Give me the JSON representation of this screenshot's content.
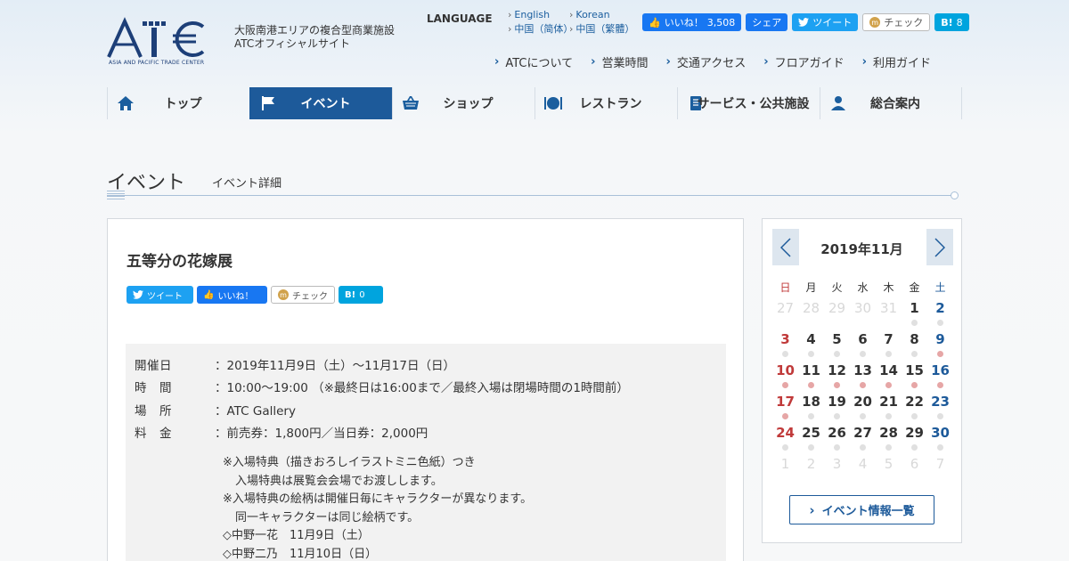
{
  "header": {
    "logo_text": "ATC",
    "logo_subtitle": "ASIA AND PACIFIC TRADE CENTER",
    "tagline_lines": [
      "大阪南港エリアの複合型商業施設",
      "ATCオフィシャルサイト"
    ],
    "language_label": "LANGUAGE",
    "languages": [
      "English",
      "Korean",
      "中国（简体）",
      "中国（繁體）"
    ],
    "social": {
      "like_label": "いいね！",
      "like_count": "3,508",
      "share_label": "シェア",
      "tweet_label": "ツイート",
      "check_label": "チェック",
      "hatena_label": "B!",
      "hatena_count": "8"
    },
    "util_links": [
      "ATCについて",
      "営業時間",
      "交通アクセス",
      "フロアガイド",
      "利用ガイド"
    ]
  },
  "nav": {
    "items": [
      {
        "label": "トップ",
        "icon": "home-icon"
      },
      {
        "label": "イベント",
        "icon": "flag-icon",
        "active": true
      },
      {
        "label": "ショップ",
        "icon": "basket-icon"
      },
      {
        "label": "レストラン",
        "icon": "dining-icon"
      },
      {
        "label": "サービス・公共施設",
        "icon": "notebook-icon"
      },
      {
        "label": "総合案内",
        "icon": "person-icon"
      }
    ]
  },
  "page": {
    "title": "イベント",
    "subtitle": "イベント詳細"
  },
  "event": {
    "title": "五等分の花嫁展",
    "share": {
      "tweet_label": "ツイート",
      "like_label": "いいね！",
      "check_label": "チェック",
      "hatena_label": "B!",
      "hatena_count": "0"
    },
    "info": [
      {
        "label": "開催日",
        "value": "：2019年11月9日（土）～11月17日（日）"
      },
      {
        "label": "時　間",
        "value": "：10:00～19:00 （※最終日は16:00まで／最終入場は閉場時間の1時間前）"
      },
      {
        "label": "場　所",
        "value": "：ATC Gallery"
      },
      {
        "label": "料　金",
        "value": "：前売券：1,800円／当日券：2,000円"
      }
    ],
    "notes": [
      {
        "text": "※入場特典（描きおろしイラストミニ色紙）つき",
        "indent": false
      },
      {
        "text": "入場特典は展覧会会場でお渡しします。",
        "indent": true
      },
      {
        "text": "※入場特典の絵柄は開催日毎にキャラクターが異なります。",
        "indent": false
      },
      {
        "text": "同一キャラクターは同じ絵柄です。",
        "indent": true
      },
      {
        "text": "◇中野一花　11月9日（土）",
        "indent": false
      },
      {
        "text": "◇中野二乃　11月10日（日）",
        "indent": false
      }
    ]
  },
  "calendar": {
    "month_label": "2019年11月",
    "weekdays": [
      "日",
      "月",
      "火",
      "水",
      "木",
      "金",
      "土"
    ],
    "weeks": [
      [
        {
          "d": "27",
          "m": true
        },
        {
          "d": "28",
          "m": true
        },
        {
          "d": "29",
          "m": true
        },
        {
          "d": "30",
          "m": true
        },
        {
          "d": "31",
          "m": true
        },
        {
          "d": "1"
        },
        {
          "d": "2"
        }
      ],
      [
        {
          "d": "3"
        },
        {
          "d": "4"
        },
        {
          "d": "5"
        },
        {
          "d": "6"
        },
        {
          "d": "7"
        },
        {
          "d": "8"
        },
        {
          "d": "9",
          "ev": true
        }
      ],
      [
        {
          "d": "10",
          "ev": true
        },
        {
          "d": "11",
          "ev": true
        },
        {
          "d": "12",
          "ev": true
        },
        {
          "d": "13",
          "ev": true
        },
        {
          "d": "14",
          "ev": true
        },
        {
          "d": "15",
          "ev": true
        },
        {
          "d": "16",
          "ev": true
        }
      ],
      [
        {
          "d": "17",
          "ev": true
        },
        {
          "d": "18"
        },
        {
          "d": "19"
        },
        {
          "d": "20"
        },
        {
          "d": "21"
        },
        {
          "d": "22"
        },
        {
          "d": "23"
        }
      ],
      [
        {
          "d": "24"
        },
        {
          "d": "25"
        },
        {
          "d": "26"
        },
        {
          "d": "27"
        },
        {
          "d": "28"
        },
        {
          "d": "29"
        },
        {
          "d": "30"
        }
      ],
      [
        {
          "d": "1",
          "m": true
        },
        {
          "d": "2",
          "m": true
        },
        {
          "d": "3",
          "m": true
        },
        {
          "d": "4",
          "m": true
        },
        {
          "d": "5",
          "m": true
        },
        {
          "d": "6",
          "m": true
        },
        {
          "d": "7",
          "m": true
        }
      ]
    ],
    "list_button_label": "イベント情報一覧"
  },
  "colors": {
    "brand": "#1d5a9a",
    "sunday": "#c03a3a",
    "saturday": "#1d5a9a",
    "event_dot": "#e6a6a6",
    "facebook": "#1877f2",
    "twitter": "#1da1f2",
    "hatena": "#00a4de"
  }
}
